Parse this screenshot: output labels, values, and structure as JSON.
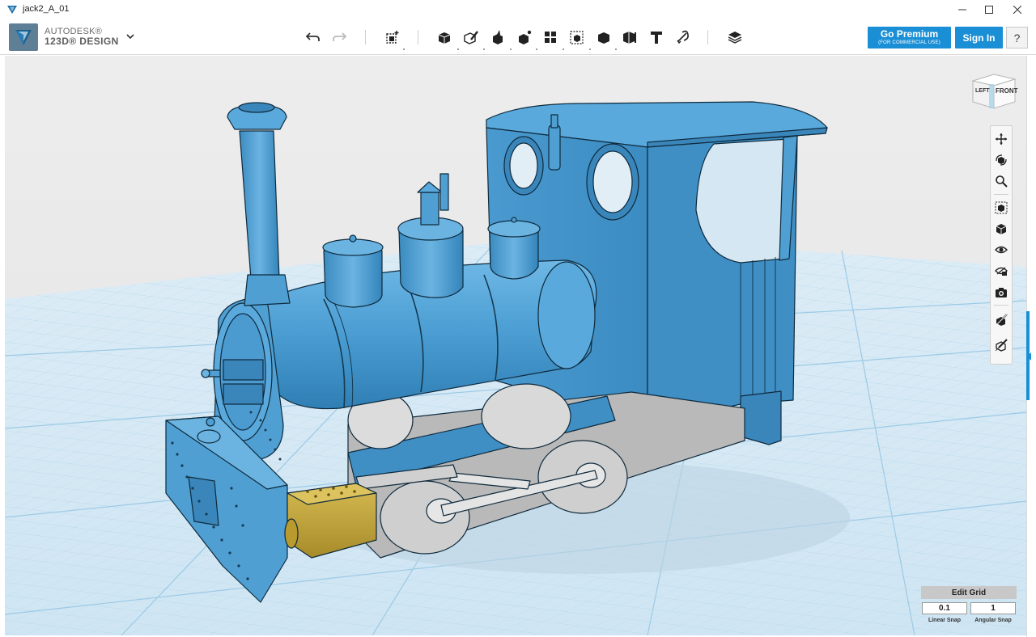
{
  "window": {
    "title": "jack2_A_01",
    "minimize_icon": "minimize-icon",
    "maximize_icon": "maximize-icon",
    "close_icon": "close-icon"
  },
  "app": {
    "brand_line1": "AUTODESK®",
    "brand_line2": "123D® DESIGN",
    "menu_icon": "chevron-down-icon"
  },
  "toolbar": {
    "tools": [
      {
        "name": "undo",
        "icon": "undo-icon"
      },
      {
        "name": "redo",
        "icon": "redo-icon"
      },
      {
        "name": "transform",
        "icon": "transform-icon"
      },
      {
        "name": "primitives",
        "icon": "box-primitive-icon"
      },
      {
        "name": "sketch",
        "icon": "sketch-icon"
      },
      {
        "name": "construct",
        "icon": "construct-icon"
      },
      {
        "name": "modify",
        "icon": "modify-icon"
      },
      {
        "name": "pattern",
        "icon": "pattern-icon"
      },
      {
        "name": "grouping",
        "icon": "grouping-icon"
      },
      {
        "name": "combine",
        "icon": "combine-icon"
      },
      {
        "name": "measure",
        "icon": "measure-icon"
      },
      {
        "name": "text",
        "icon": "text-icon"
      },
      {
        "name": "snap",
        "icon": "snap-icon"
      },
      {
        "name": "material",
        "icon": "layers-icon"
      }
    ]
  },
  "account": {
    "premium_label": "Go Premium",
    "premium_sub": "(FOR COMMERCIAL USE)",
    "signin_label": "Sign In",
    "help_label": "?"
  },
  "viewcube": {
    "left_face": "LEFT",
    "front_face": "FRONT"
  },
  "navbar": {
    "tools": [
      "pan-icon",
      "orbit-icon",
      "zoom-icon",
      "fit-icon",
      "view-icon",
      "visibility-icon",
      "materials-icon",
      "screenshot-icon",
      "hide-sketch-icon",
      "hide-mesh-icon"
    ]
  },
  "grid": {
    "title": "Edit Grid",
    "linear_value": "0.1",
    "angular_value": "1",
    "linear_label": "Linear Snap",
    "angular_label": "Angular Snap"
  },
  "colors": {
    "accent": "#1a8fd6",
    "model_blue": "#4f9fd3",
    "model_brass": "#c7a93c",
    "grid_bg": "#dcecf6"
  }
}
